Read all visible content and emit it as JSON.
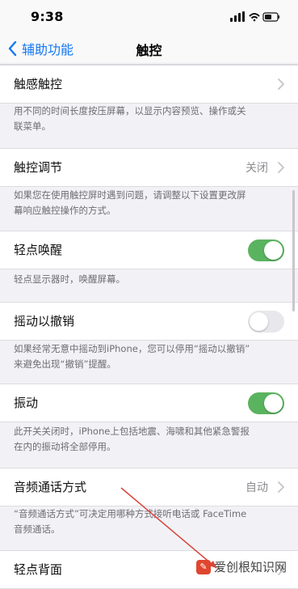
{
  "status_bar": {
    "time": "9:38",
    "icons": [
      "cellular-signal-icon",
      "wifi-icon",
      "battery-icon"
    ]
  },
  "nav": {
    "back_label": "辅助功能",
    "title": "触控"
  },
  "rows": {
    "haptic_touch": {
      "label": "触感触控"
    },
    "touch_accommodations": {
      "label": "触控调节",
      "value": "关闭"
    },
    "tap_to_wake": {
      "label": "轻点唤醒",
      "enabled": true
    },
    "shake_to_undo": {
      "label": "摇动以撤销",
      "enabled": false
    },
    "vibration": {
      "label": "振动",
      "enabled": true
    },
    "call_audio_routing": {
      "label": "音频通话方式",
      "value": "自动"
    },
    "back_tap": {
      "label": "轻点背面"
    }
  },
  "descriptions": {
    "haptic_touch_1": "用不同的时间长度按压屏幕，以显示内容预览、操作或关",
    "haptic_touch_2": "联菜单。",
    "touch_accommodations_1": "如果您在使用触控屏时遇到问题，请调整以下设置更改屏",
    "touch_accommodations_2": "幕响应触控操作的方式。",
    "tap_to_wake": "轻点显示器时，唤醒屏幕。",
    "shake_to_undo_1": "如果经常无意中摇动到iPhone，您可以停用“摇动以撤销”",
    "shake_to_undo_2": "来避免出现“撤销”提醒。",
    "vibration_1": "此开关关闭时，iPhone上包括地震、海啸和其他紧急警报",
    "vibration_2": "在内的振动将全部停用。",
    "call_audio_routing_1": "“音频通话方式”可决定用哪种方式接听电话或 FaceTime",
    "call_audio_routing_2": "音频通话。"
  },
  "watermark": {
    "text": "爱创根知识网"
  },
  "colors": {
    "accent": "#1477f6",
    "toggle_on": "#5ab35e",
    "background": "#f2f2f6",
    "annotation_arrow": "#d9453c"
  }
}
